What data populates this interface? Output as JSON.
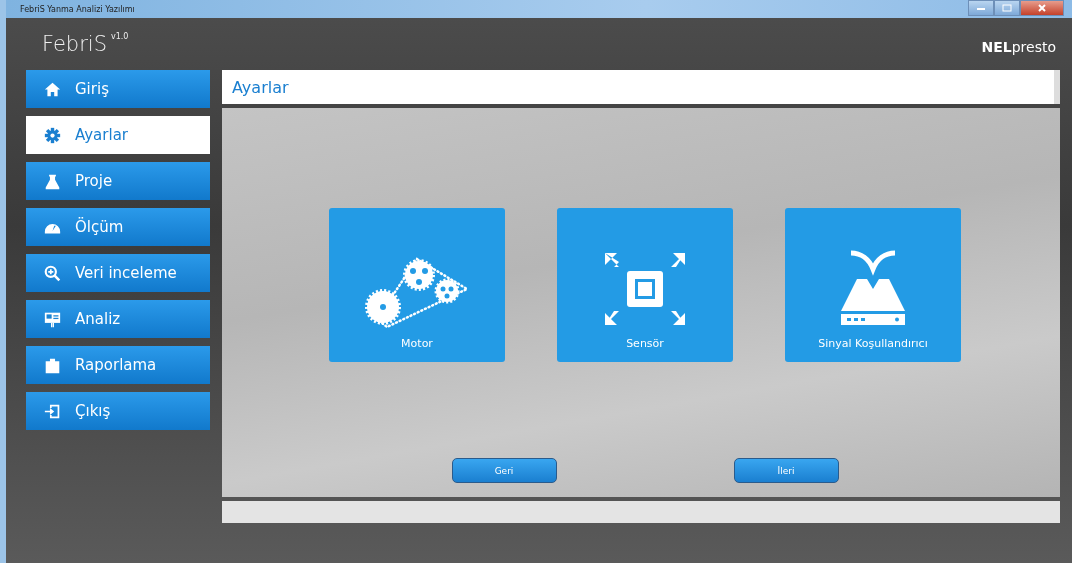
{
  "window": {
    "title": "FebriS Yanma Analizi Yazılımı"
  },
  "app": {
    "name": "FebriS",
    "version": "v1.0",
    "logo": "**NEL**presto"
  },
  "sidebar": {
    "items": [
      {
        "label": "Giriş",
        "kind": "home",
        "selected": false
      },
      {
        "label": "Ayarlar",
        "kind": "gear",
        "selected": true
      },
      {
        "label": "Proje",
        "kind": "flask",
        "selected": false
      },
      {
        "label": "Ölçüm",
        "kind": "gauge",
        "selected": false
      },
      {
        "label": "Veri inceleme",
        "kind": "zoom",
        "selected": false
      },
      {
        "label": "Analiz",
        "kind": "board",
        "selected": false
      },
      {
        "label": "Raporlama",
        "kind": "clipboard",
        "selected": false
      },
      {
        "label": "Çıkış",
        "kind": "exit",
        "selected": false
      }
    ]
  },
  "page": {
    "title": "Ayarlar",
    "tiles": [
      {
        "label": "Motor",
        "kind": "gears"
      },
      {
        "label": "Sensör",
        "kind": "chip"
      },
      {
        "label": "Sinyal Koşullandırıcı",
        "kind": "funnel"
      }
    ],
    "buttons": [
      {
        "label": "Geri"
      },
      {
        "label": "İleri"
      }
    ]
  }
}
